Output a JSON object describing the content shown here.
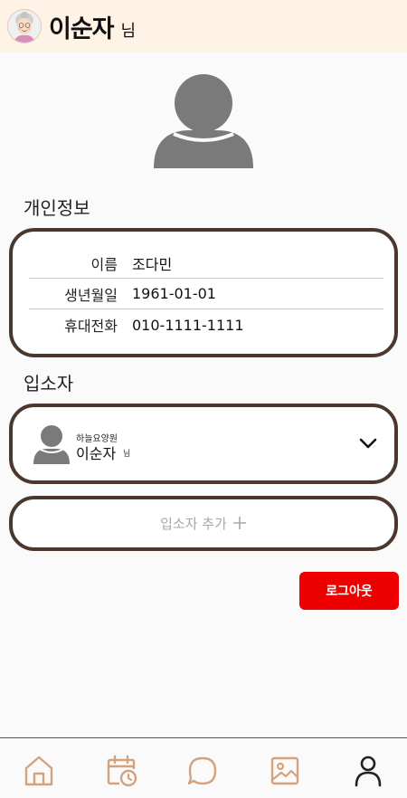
{
  "header": {
    "name": "이순자",
    "suffix": "님"
  },
  "sections": {
    "personal_info_title": "개인정보",
    "resident_title": "입소자"
  },
  "personal_info": [
    {
      "label": "이름",
      "value": "조다민"
    },
    {
      "label": "생년월일",
      "value": "1961-01-01"
    },
    {
      "label": "휴대전화",
      "value": "010-1111-1111"
    }
  ],
  "resident": {
    "facility": "하늘요양원",
    "name": "이순자",
    "suffix": "님"
  },
  "add_resident": {
    "label": "입소자 추가",
    "icon": "plus-icon"
  },
  "logout_label": "로그아웃",
  "nav": {
    "items": [
      "home-icon",
      "calendar-clock-icon",
      "chat-icon",
      "gallery-icon",
      "profile-icon"
    ]
  },
  "colors": {
    "header_bg": "#fff3e6",
    "card_border": "#4a382e",
    "logout_bg": "#ee0000",
    "nav_icon": "#d4a27c",
    "nav_active": "#222222"
  }
}
